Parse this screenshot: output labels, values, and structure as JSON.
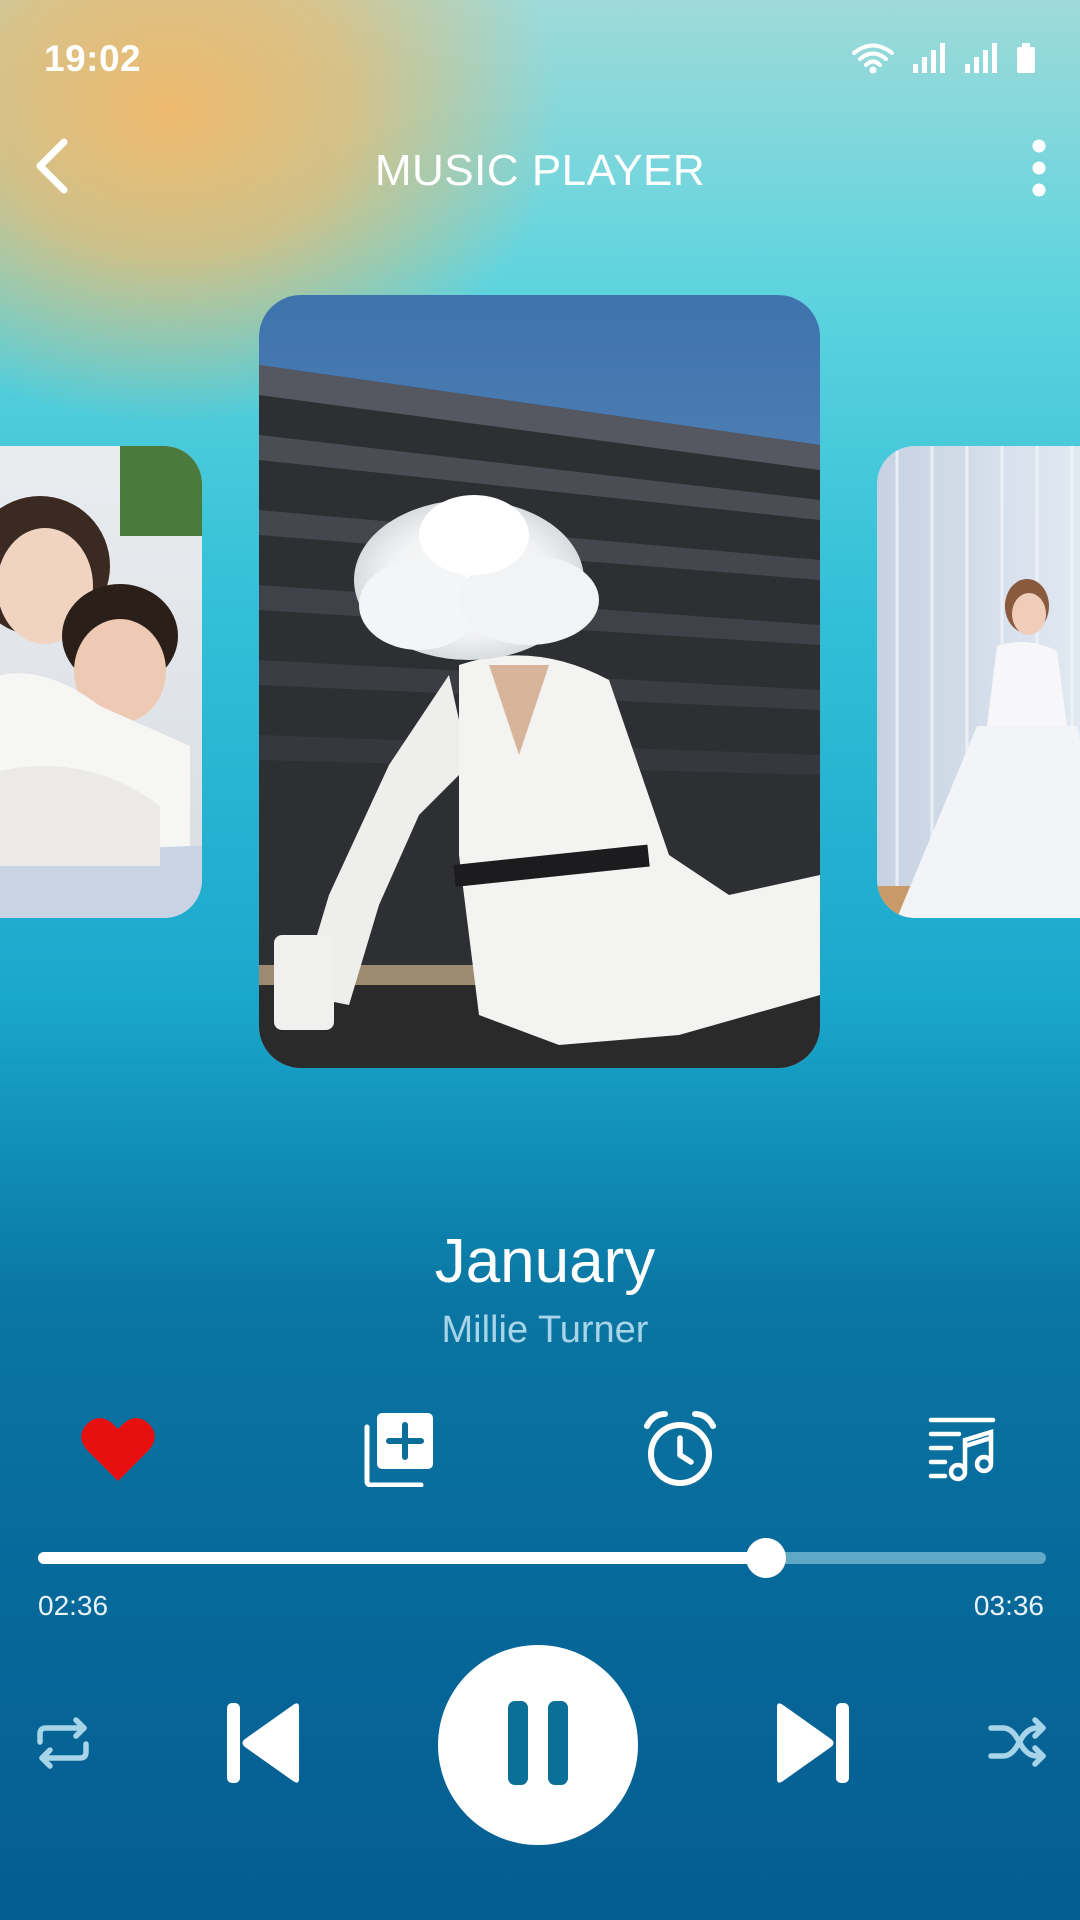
{
  "status_bar": {
    "time": "19:02",
    "icons": [
      "wifi-icon",
      "signal-icon",
      "signal-icon",
      "battery-icon"
    ]
  },
  "header": {
    "title": "MUSIC PLAYER",
    "back_icon": "chevron-left-icon",
    "menu_icon": "more-vertical-icon"
  },
  "carousel": {
    "cards": [
      "previous-album-art",
      "current-album-art",
      "next-album-art"
    ]
  },
  "track": {
    "title": "January",
    "artist": "Millie Turner"
  },
  "actions": [
    {
      "name": "favorite",
      "icon": "heart-icon",
      "color": "#e8100f"
    },
    {
      "name": "add-to-playlist",
      "icon": "playlist-add-icon"
    },
    {
      "name": "sleep-timer",
      "icon": "alarm-clock-icon"
    },
    {
      "name": "queue",
      "icon": "music-list-icon"
    }
  ],
  "playback": {
    "elapsed": "02:36",
    "total": "03:36",
    "progress": 0.722
  },
  "controls": {
    "repeat_icon": "repeat-icon",
    "previous_icon": "skip-previous-icon",
    "play_pause_icon": "pause-icon",
    "next_icon": "skip-next-icon",
    "shuffle_icon": "shuffle-icon"
  },
  "colors": {
    "accent_red": "#e8100f",
    "progress_track": "#5fa8c6",
    "progress_fill": "#ffffff",
    "artist_text": "#a7d4e8"
  }
}
